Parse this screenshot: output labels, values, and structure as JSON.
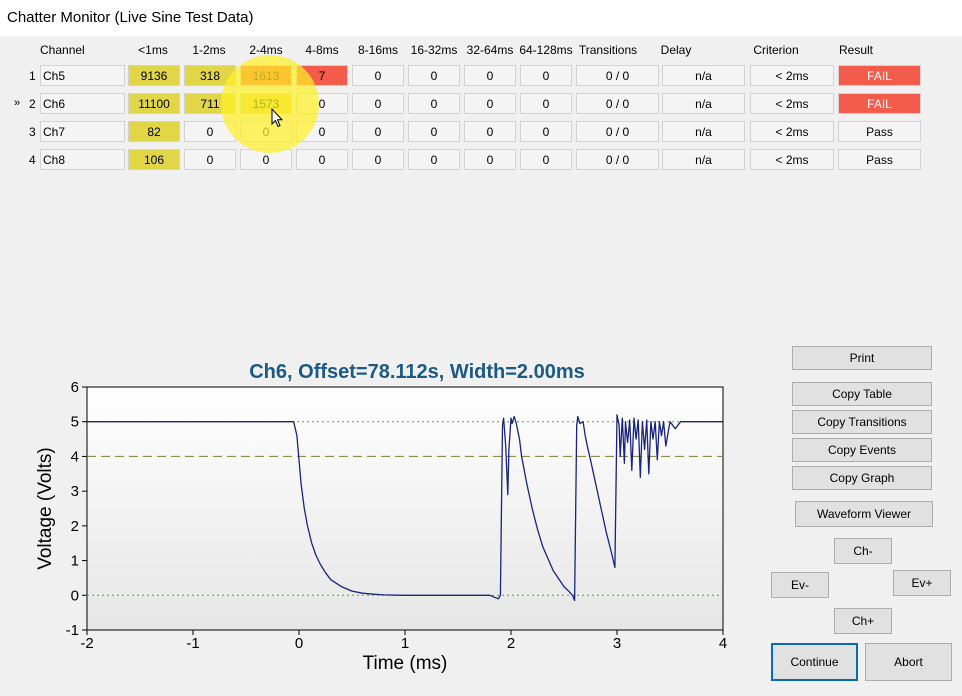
{
  "window": {
    "title": "Chatter Monitor (Live Sine Test Data)"
  },
  "table": {
    "headers": [
      "Channel",
      "<1ms",
      "1-2ms",
      "2-4ms",
      "4-8ms",
      "8-16ms",
      "16-32ms",
      "32-64ms",
      "64-128ms",
      "Transitions",
      "Delay",
      "Criterion",
      "Result"
    ],
    "rows": [
      {
        "num": "1",
        "marker": "",
        "channel": "Ch5",
        "c1": "9136",
        "c2": "318",
        "c3": "1613",
        "c4": "7",
        "c5": "0",
        "c6": "0",
        "c7": "0",
        "c8": "0",
        "transitions": "0 / 0",
        "delay": "n/a",
        "criterion": "< 2ms",
        "result": "FAIL"
      },
      {
        "num": "2",
        "marker": "»",
        "channel": "Ch6",
        "c1": "11100",
        "c2": "711",
        "c3": "1573",
        "c4": "0",
        "c5": "0",
        "c6": "0",
        "c7": "0",
        "c8": "0",
        "transitions": "0 / 0",
        "delay": "n/a",
        "criterion": "< 2ms",
        "result": "FAIL"
      },
      {
        "num": "3",
        "marker": "",
        "channel": "Ch7",
        "c1": "82",
        "c2": "0",
        "c3": "0",
        "c4": "0",
        "c5": "0",
        "c6": "0",
        "c7": "0",
        "c8": "0",
        "transitions": "0 / 0",
        "delay": "n/a",
        "criterion": "< 2ms",
        "result": "Pass"
      },
      {
        "num": "4",
        "marker": "",
        "channel": "Ch8",
        "c1": "106",
        "c2": "0",
        "c3": "0",
        "c4": "0",
        "c5": "0",
        "c6": "0",
        "c7": "0",
        "c8": "0",
        "transitions": "0 / 0",
        "delay": "n/a",
        "criterion": "< 2ms",
        "result": "Pass"
      }
    ]
  },
  "buttons": {
    "print": "Print",
    "copy_table": "Copy Table",
    "copy_transitions": "Copy Transitions",
    "copy_events": "Copy Events",
    "copy_graph": "Copy Graph",
    "waveform_viewer": "Waveform Viewer",
    "ch_minus": "Ch-",
    "ev_minus": "Ev-",
    "ev_plus": "Ev+",
    "ch_plus": "Ch+",
    "continue": "Continue",
    "abort": "Abort"
  },
  "colors": {
    "yellow_cell": "#e0d647",
    "red_cell": "#f35b4a",
    "trace": "#1a237e",
    "title": "#1b5a85",
    "threshold": "#8b7a2a",
    "level_lines": "#2fbf2f"
  },
  "chart_data": {
    "type": "line",
    "title": "Ch6, Offset=78.112s, Width=2.00ms",
    "xlabel": "Time (ms)",
    "ylabel": "Voltage (Volts)",
    "xlim": [
      -2,
      4
    ],
    "ylim": [
      -1,
      6
    ],
    "xticks": [
      "-2",
      "-1",
      "0",
      "1",
      "2",
      "3",
      "4"
    ],
    "yticks": [
      "-1",
      "0",
      "1",
      "2",
      "3",
      "4",
      "5",
      "6"
    ],
    "reference_lines": [
      {
        "y": 5,
        "style": "dotted",
        "color": "green"
      },
      {
        "y": 4,
        "style": "dashed",
        "color": "olive"
      },
      {
        "y": 0,
        "style": "dotted",
        "color": "green"
      }
    ],
    "series": [
      {
        "x": [
          -2,
          -0.05,
          -0.02,
          0.0,
          0.02,
          0.05,
          0.08,
          0.12,
          0.16,
          0.2,
          0.25,
          0.3,
          0.4,
          0.5,
          0.6,
          0.7,
          0.8,
          1.0,
          1.2,
          1.4,
          1.6,
          1.8,
          1.88,
          1.9,
          1.92,
          1.93,
          1.95,
          1.97,
          1.98,
          2.0,
          2.01,
          2.03,
          2.05,
          2.08,
          2.1,
          2.15,
          2.2,
          2.25,
          2.3,
          2.4,
          2.5,
          2.55,
          2.58,
          2.6,
          2.62,
          2.63,
          2.65,
          2.68,
          2.7,
          2.72,
          2.75,
          2.8,
          2.85,
          2.9,
          2.95,
          2.98,
          3.0,
          3.02,
          3.03,
          3.05,
          3.07,
          3.08,
          3.1,
          3.12,
          3.14,
          3.16,
          3.18,
          3.2,
          3.22,
          3.24,
          3.26,
          3.28,
          3.3,
          3.32,
          3.34,
          3.36,
          3.38,
          3.4,
          3.42,
          3.44,
          3.46,
          3.5,
          3.55,
          3.6,
          3.7,
          3.8,
          4.0
        ],
        "y": [
          5.0,
          5.0,
          4.6,
          3.9,
          3.2,
          2.5,
          2.0,
          1.5,
          1.15,
          0.9,
          0.65,
          0.45,
          0.25,
          0.12,
          0.06,
          0.03,
          0.01,
          0.0,
          0.0,
          0.0,
          0.0,
          0.0,
          -0.1,
          0.0,
          4.9,
          5.1,
          4.3,
          2.9,
          4.2,
          5.1,
          4.95,
          5.15,
          4.95,
          4.5,
          4.0,
          3.2,
          2.5,
          1.9,
          1.4,
          0.7,
          0.25,
          0.1,
          0.0,
          -0.15,
          4.9,
          5.15,
          4.95,
          5.0,
          4.6,
          4.3,
          3.9,
          3.2,
          2.5,
          1.8,
          1.2,
          0.8,
          5.2,
          4.9,
          4.0,
          5.1,
          3.8,
          5.0,
          4.4,
          5.05,
          3.6,
          5.1,
          4.5,
          5.05,
          3.4,
          5.0,
          4.2,
          5.05,
          3.5,
          5.0,
          4.5,
          5.0,
          3.9,
          5.0,
          4.6,
          5.0,
          4.3,
          5.0,
          4.8,
          5.0,
          5.0,
          5.0,
          5.0
        ]
      }
    ]
  }
}
